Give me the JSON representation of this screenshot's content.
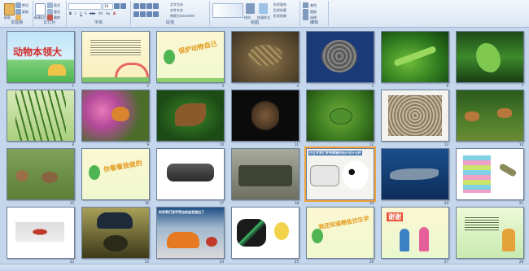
{
  "ribbon": {
    "groups": [
      {
        "label": "剪贴板",
        "items": [
          "粘贴",
          "剪切",
          "复制",
          "格式刷"
        ]
      },
      {
        "label": "幻灯片",
        "items": [
          "新建幻灯片",
          "版式",
          "重设",
          "删除"
        ]
      },
      {
        "label": "字体",
        "items": [
          "B",
          "I",
          "U",
          "S",
          "abc",
          "AV",
          "Aa",
          "A"
        ]
      },
      {
        "label": "段落",
        "items": [
          "文字方向",
          "对齐文本",
          "转换为SmartArt"
        ]
      },
      {
        "label": "绘图",
        "items": [
          "排列",
          "快速样式",
          "形状填充",
          "形状轮廓",
          "形状效果"
        ]
      },
      {
        "label": "编辑",
        "items": [
          "查找",
          "替换",
          "选择"
        ]
      }
    ],
    "font_name": "",
    "font_size": "18"
  },
  "slides": [
    {
      "num": "1",
      "title": "动物本领大"
    },
    {
      "num": "2",
      "title": ""
    },
    {
      "num": "3",
      "title": "保护动物自己"
    },
    {
      "num": "4",
      "title": ""
    },
    {
      "num": "5",
      "title": ""
    },
    {
      "num": "6",
      "title": ""
    },
    {
      "num": "7",
      "title": ""
    },
    {
      "num": "8",
      "title": ""
    },
    {
      "num": "9",
      "title": ""
    },
    {
      "num": "10",
      "title": ""
    },
    {
      "num": "11",
      "title": ""
    },
    {
      "num": "12",
      "title": ""
    },
    {
      "num": "13",
      "title": ""
    },
    {
      "num": "14",
      "title": ""
    },
    {
      "num": "15",
      "title": ""
    },
    {
      "num": "16",
      "title": "你看看我做的"
    },
    {
      "num": "17",
      "title": ""
    },
    {
      "num": "18",
      "title": ""
    },
    {
      "num": "19",
      "title": "仿生学家们受到熊猫的启示设计出的"
    },
    {
      "num": "20",
      "title": ""
    },
    {
      "num": "21",
      "title": ""
    },
    {
      "num": "22",
      "title": ""
    },
    {
      "num": "23",
      "title": ""
    },
    {
      "num": "24",
      "title": "科学家们受甲壳虫的启发造出了"
    },
    {
      "num": "25",
      "title": ""
    },
    {
      "num": "26",
      "title": "我还知道哪些仿生学"
    },
    {
      "num": "27",
      "title": "谢谢"
    },
    {
      "num": "28",
      "title": ""
    }
  ],
  "status": {
    "zoom": ""
  },
  "colors": {
    "selected": "#f0a43a",
    "background": "#c4d6ec"
  }
}
